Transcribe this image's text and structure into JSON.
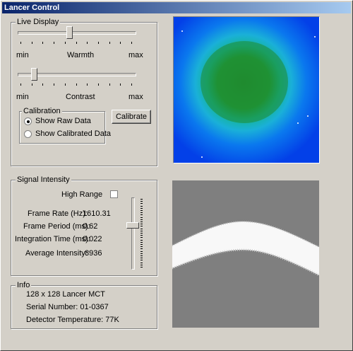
{
  "window": {
    "title": "Lancer Control"
  },
  "live_display": {
    "group_label": "Live Display",
    "warmth": {
      "min_label": "min",
      "label": "Warmth",
      "max_label": "max",
      "level": 0.44
    },
    "contrast": {
      "min_label": "min",
      "label": "Contrast",
      "max_label": "max",
      "level": 0.12
    },
    "calibration": {
      "group_label": "Calibration",
      "options": [
        "Show Raw Data",
        "Show Calibrated Data"
      ],
      "selected": "Show Raw Data"
    },
    "calibrate_button": "Calibrate"
  },
  "signal_intensity": {
    "group_label": "Signal Intensity",
    "high_range_label": "High Range",
    "high_range_checked": false,
    "frame_rate_label": "Frame Rate (Hz):",
    "frame_rate_value": "1610.31",
    "frame_period_label": "Frame Period (ms):",
    "frame_period_value": "0.62",
    "integration_time_label": "Integration Time (ms):",
    "integration_time_value": "0.022",
    "average_intensity_label": "Average Intensity:",
    "average_intensity_value": "8936",
    "slider_level": 0.38
  },
  "info": {
    "group_label": "Info",
    "line1": "128 x 128 Lancer MCT",
    "line2": "Serial Number: 01-0367",
    "line3": "Detector Temperature:  77K"
  },
  "colors": {
    "title_start": "#0a246a",
    "title_end": "#a6caf0",
    "image_bg": "#0044ee",
    "image_hot": "#1a8a3a",
    "plot_bg": "#7f7f7f"
  }
}
